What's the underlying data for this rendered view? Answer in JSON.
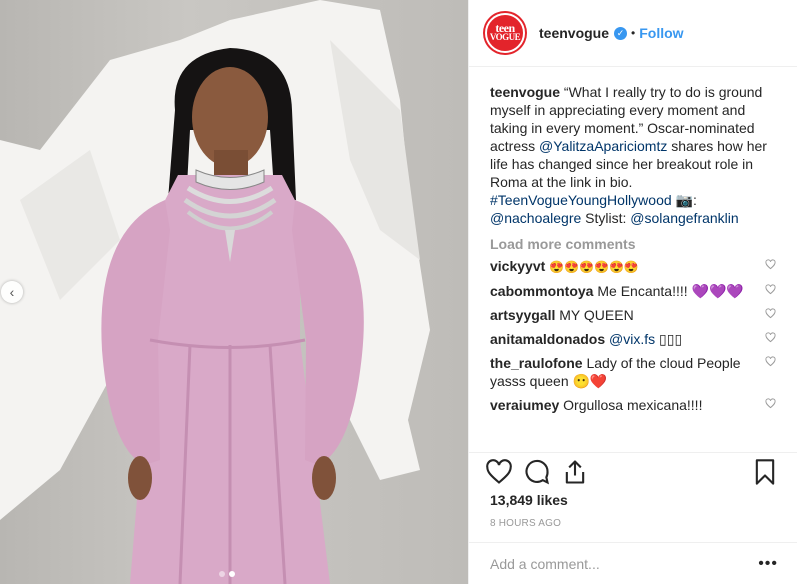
{
  "post": {
    "account": {
      "username": "teenvogue",
      "avatar_line1": "teen",
      "avatar_line2": "VOGUE",
      "verified_icon": "verified-check-icon"
    },
    "bullet": "•",
    "follow_label": "Follow",
    "caption": {
      "username": "teenvogue",
      "text_1": "“What I really try to do is ground myself in appreciating every moment and taking in every moment.” Oscar-nominated actress ",
      "mention_1": "@YalitzaApariciomtz",
      "text_2": " shares how her life has changed since her breakout role in Roma at the link in bio. ",
      "hashtag": "#TeenVogueYoungHollywood",
      "text_3": " 📷: ",
      "mention_2": "@nachoalegre",
      "text_4": " Stylist: ",
      "mention_3": "@solangefranklin"
    },
    "load_more_label": "Load more comments",
    "comments": [
      {
        "user": "vickyyvt",
        "text": "😍😍😍😍😍😍"
      },
      {
        "user": "cabommontoya",
        "text": "Me Encanta!!!! 💜💜💜"
      },
      {
        "user": "artsyygall",
        "text": "MY QUEEN"
      },
      {
        "user": "anitamaldonados",
        "mention": "@vix.fs",
        "text": "▯▯▯"
      },
      {
        "user": "the_raulofone",
        "text": "Lady of the cloud People yasss queen 😶❤️"
      },
      {
        "user": "veraiumey",
        "text": "Orgullosa mexicana!!!!"
      }
    ],
    "likes": "13,849 likes",
    "timestamp": "8 HOURS AGO",
    "add_comment_placeholder": "Add a comment...",
    "more_options": "•••",
    "carousel": {
      "prev_icon": "chevron-left-icon",
      "total": 2,
      "active": 2
    }
  },
  "colors": {
    "link_blue": "#3897f0",
    "mention": "#003569",
    "brand_red": "#e3242b",
    "muted": "#999999"
  }
}
